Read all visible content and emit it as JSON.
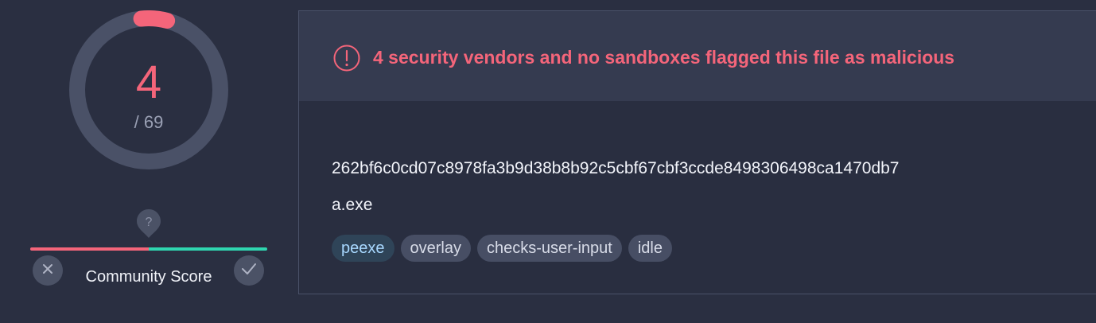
{
  "detection": {
    "score": "4",
    "total": "/ 69",
    "fraction": 0.058
  },
  "community": {
    "label": "Community Score",
    "unknown_icon": "question-pin-icon",
    "harmful_icon": "x-icon",
    "harmless_icon": "check-icon"
  },
  "alert": {
    "icon": "exclamation-circle-icon",
    "text": "4 security vendors and no sandboxes flagged this file as malicious"
  },
  "file": {
    "hash": "262bf6c0cd07c8978fa3b9d38b8b92c5cbf67cbf3ccde8498306498ca1470db7",
    "name": "a.exe",
    "tags": [
      {
        "label": "peexe"
      },
      {
        "label": "overlay"
      },
      {
        "label": "checks-user-input"
      },
      {
        "label": "idle"
      }
    ]
  },
  "colors": {
    "malicious": "#f4657a",
    "harmless": "#2fd6b0",
    "background": "#2a2f41"
  }
}
